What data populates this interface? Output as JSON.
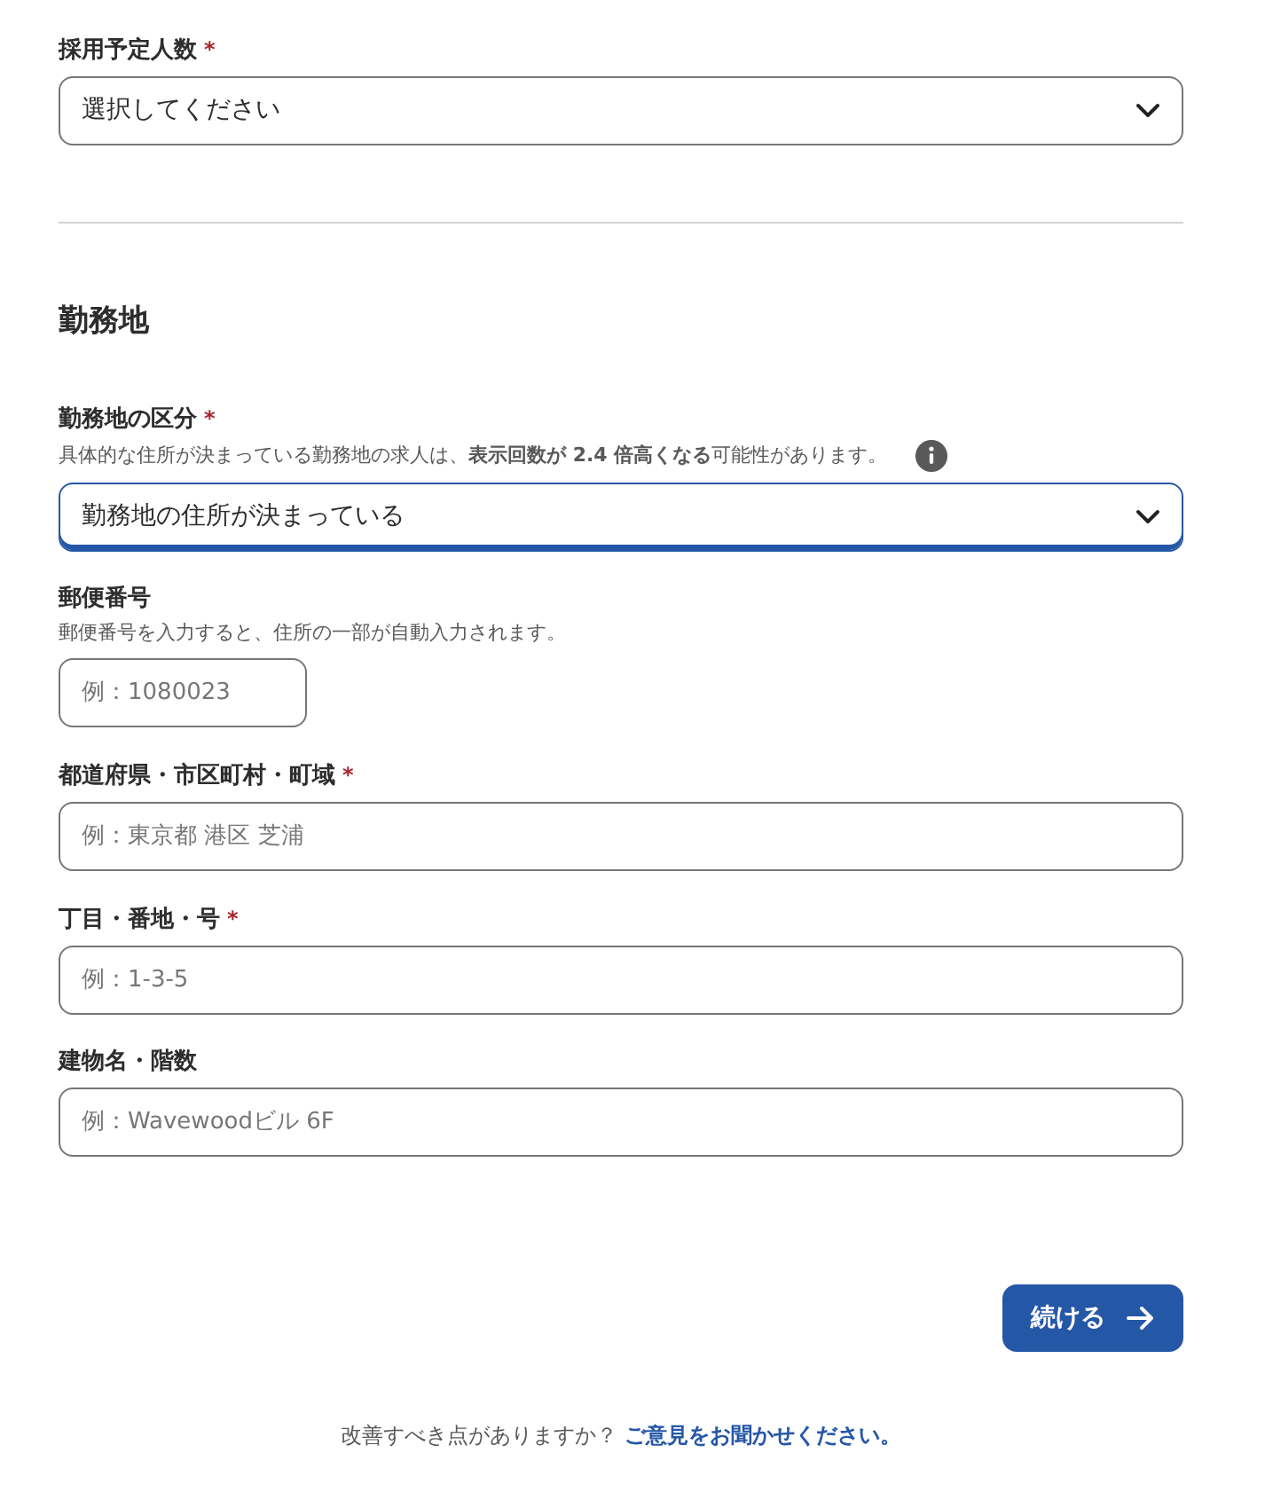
{
  "required_mark": "*",
  "sections": [
    {
      "fields": [
        {
          "kind": "select",
          "label": "採用予定人数",
          "required": true,
          "value": "選択してください",
          "focused": false
        }
      ]
    },
    {
      "heading": "勤務地",
      "fields": [
        {
          "kind": "select",
          "label": "勤務地の区分",
          "required": true,
          "hint": "具体的な住所が決まっている勤務地の求人は、**表示回数が 2.4 倍高くなる**可能性があります。",
          "info": true,
          "value": "勤務地の住所が決まっている",
          "focused": true
        },
        {
          "kind": "short_text",
          "label": "郵便番号",
          "required": false,
          "hint": "郵便番号を入力すると、住所の一部が自動入力されます。",
          "placeholder": "例：1080023"
        },
        {
          "kind": "text",
          "label": "都道府県・市区町村・町域",
          "required": true,
          "placeholder": "例：東京都 港区 芝浦"
        },
        {
          "kind": "text",
          "label": "丁目・番地・号",
          "required": true,
          "placeholder": "例：1-3-5"
        },
        {
          "kind": "text",
          "label": "建物名・階数",
          "required": false,
          "placeholder": "例：Wavewoodビル 6F"
        }
      ]
    }
  ],
  "continue_button": "続ける",
  "feedback": {
    "question": "改善すべき点がありますか？",
    "link": "ご意見をお聞かせください。"
  }
}
